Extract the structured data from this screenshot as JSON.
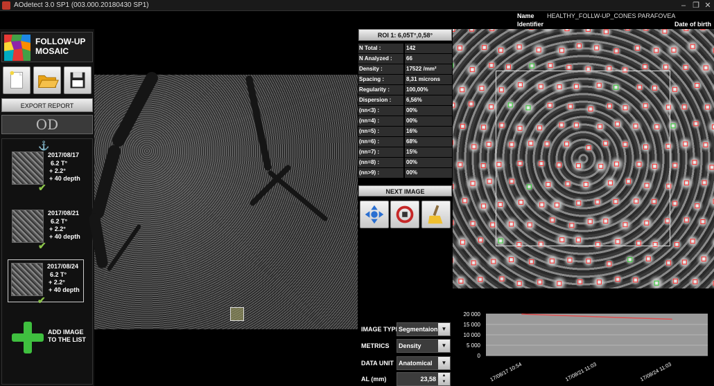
{
  "window": {
    "title": "AOdetect 3.0 SP1 (003.000.20180430 SP1)",
    "controls": [
      "–",
      "❐",
      "✕"
    ]
  },
  "patient": {
    "name_label": "Name",
    "name_value": "HEALTHY_FOLLW-UP_CONES PARAFOVEA",
    "identifier_label": "Identifier",
    "dob_label": "Date of birth"
  },
  "sidebar": {
    "logo_line1": "FOLLOW-UP",
    "logo_line2": "MOSAIC",
    "export_label": "EXPORT REPORT",
    "eye": "OD",
    "exams": [
      {
        "date": "2017/08/17",
        "angle": "6.2 T°",
        "offset": "+  2.2°",
        "depth": "+  40 depth",
        "selected": false
      },
      {
        "date": "2017/08/21",
        "angle": "6.2 T°",
        "offset": "+  2.2°",
        "depth": "+  40 depth",
        "selected": false
      },
      {
        "date": "2017/08/24",
        "angle": "6.2 T°",
        "offset": "+  2.2°",
        "depth": "+  40 depth",
        "selected": true
      }
    ],
    "add_line1": "ADD IMAGE",
    "add_line2": "TO THE LIST"
  },
  "roi": {
    "label": "ROI 1: 6,05T°,0,58°",
    "stats": [
      {
        "k": "N Total :",
        "v": "142"
      },
      {
        "k": "N Analyzed :",
        "v": "66"
      },
      {
        "k": "Density :",
        "v": "17522 /mm²"
      },
      {
        "k": "Spacing :",
        "v": "8,31 microns"
      },
      {
        "k": "Regularity :",
        "v": "100,00%"
      },
      {
        "k": "Dispersion :",
        "v": "6,56%"
      },
      {
        "k": "(nn<3) :",
        "v": "00%"
      },
      {
        "k": "(nn=4) :",
        "v": "00%"
      },
      {
        "k": "(nn=5) :",
        "v": "16%"
      },
      {
        "k": "(nn=6) :",
        "v": "68%"
      },
      {
        "k": "(nn=7) :",
        "v": "15%"
      },
      {
        "k": "(nn=8) :",
        "v": "00%"
      },
      {
        "k": "(nn>9) :",
        "v": "00%"
      }
    ],
    "next_label": "NEXT IMAGE"
  },
  "form": {
    "image_type_label": "IMAGE TYPE",
    "image_type_value": "Segmentaion",
    "metrics_label": "METRICS",
    "metrics_value": "Density",
    "data_unit_label": "DATA UNIT",
    "data_unit_value": "Anatomical",
    "al_label": "AL (mm)",
    "al_value": "23,58"
  },
  "chart_data": {
    "type": "line",
    "categories": [
      "17/08/17 10:54",
      "17/08/21 11:03",
      "17/08/24 11:03"
    ],
    "series": [
      {
        "values": [
          20000,
          18700,
          17522
        ],
        "color": "#e05050"
      }
    ],
    "yticks": [
      "20 000",
      "15 000",
      "10 000",
      "5 000",
      "0"
    ],
    "ylim": [
      0,
      20000
    ],
    "grid": true
  },
  "colors": {
    "accent_green": "#3fbf3f",
    "marker_red": "#ff3030",
    "marker_green": "#30d030"
  }
}
